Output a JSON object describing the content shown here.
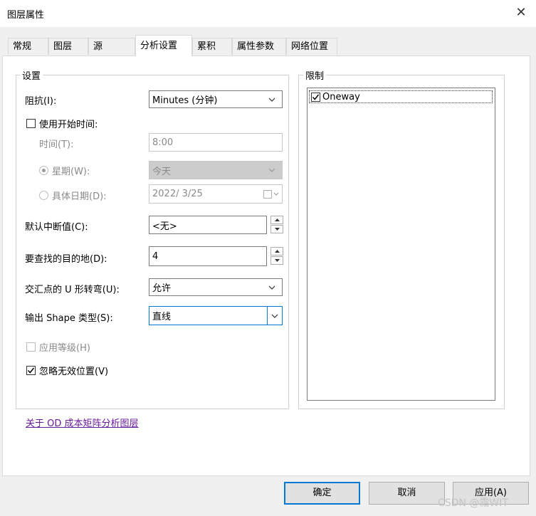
{
  "window": {
    "title": "图层属性"
  },
  "tabs": [
    {
      "label": "常规"
    },
    {
      "label": "图层"
    },
    {
      "label": "源"
    },
    {
      "label": "分析设置"
    },
    {
      "label": "累积"
    },
    {
      "label": "属性参数"
    },
    {
      "label": "网络位置"
    }
  ],
  "settings": {
    "group_label": "设置",
    "impedance": {
      "label": "阻抗(I):",
      "value": "Minutes (分钟)"
    },
    "use_start_time": {
      "label": "使用开始时间:",
      "checked": false
    },
    "time": {
      "label": "时间(T):",
      "value": "8:00"
    },
    "weekday": {
      "label": "星期(W):",
      "value": "今天",
      "selected": true
    },
    "specific_date": {
      "label": "具体日期(D):",
      "value": "2022/  3/25",
      "selected": false
    },
    "default_cutoff": {
      "label": "默认中断值(C):",
      "value": "<无>"
    },
    "destinations": {
      "label": "要查找的目的地(D):",
      "value": "4"
    },
    "uturns": {
      "label": "交汇点的 U 形转弯(U):",
      "value": "允许"
    },
    "shape_type": {
      "label": "输出 Shape 类型(S):",
      "value": "直线"
    },
    "use_hierarchy": {
      "label": "应用等级(H)",
      "checked": false
    },
    "ignore_invalid": {
      "label": "忽略无效位置(V)",
      "checked": true
    }
  },
  "restrictions": {
    "group_label": "限制",
    "items": [
      {
        "label": "Oneway",
        "checked": true
      }
    ]
  },
  "help_link": "关于 OD 成本矩阵分析图层",
  "buttons": {
    "ok": "确定",
    "cancel": "取消",
    "apply": "应用(A)"
  },
  "watermark": "CSDN @霜WIT",
  "colors": {
    "accent": "#0078d7",
    "link": "#6a1b9a"
  }
}
